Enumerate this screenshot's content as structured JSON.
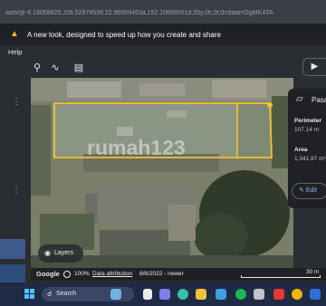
{
  "browser": {
    "url": "web/@-6.18058825,106.52978539,22.95069463a,152.10689001d,35y,0h,0t,0r/data=OgMKATA"
  },
  "banner": {
    "icon": "megaphone-icon",
    "text": "A new look, designed to speed up how you create and share"
  },
  "menu": {
    "help_label": "Help"
  },
  "toolbar": {
    "icons": [
      "pin-icon",
      "path-icon",
      "ruler-icon"
    ],
    "present_icon": "present-icon"
  },
  "map": {
    "watermark": "rumah123",
    "layers_label": "Layers"
  },
  "card": {
    "title": "Pasa",
    "perimeter_label": "Perimeter",
    "perimeter_value": "107.14 m",
    "area_label": "Area",
    "area_value": "1,341.87 m²",
    "edit_label": "Edit"
  },
  "statusbar": {
    "google": "Google",
    "zoom": "100%",
    "data_attribution": "Data attribution",
    "imagery_date": "8/6/2022 - newer",
    "scale": "30 m"
  },
  "taskbar": {
    "search_label": "Search"
  },
  "colors": {
    "polygon_outline": "#f6c02d",
    "accent_blue": "#8ab4f8"
  }
}
